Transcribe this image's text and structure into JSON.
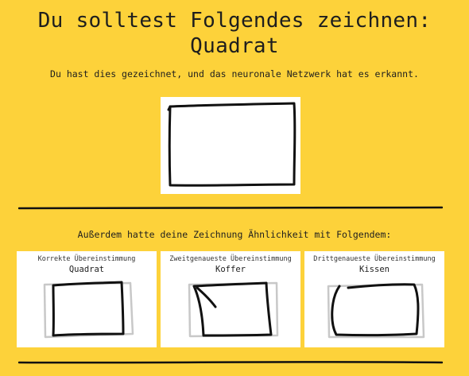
{
  "prompt": {
    "line1": "Du solltest Folgendes zeichnen:",
    "line2": "Quadrat"
  },
  "result_message": "Du hast dies gezeichnet, und das neuronale Netzwerk hat es erkannt.",
  "similarity_heading": "Außerdem hatte deine Zeichnung Ähnlichkeit mit Folgendem:",
  "matches": [
    {
      "rank_label": "Korrekte Übereinstimmung",
      "word": "Quadrat"
    },
    {
      "rank_label": "Zweitgenaueste Übereinstimmung",
      "word": "Koffer"
    },
    {
      "rank_label": "Drittgenaueste Übereinstimmung",
      "word": "Kissen"
    }
  ],
  "colors": {
    "background": "#FDD23A",
    "card": "#FFFFFF",
    "ink": "#111111",
    "reference_sketch": "#C8C8C8"
  }
}
